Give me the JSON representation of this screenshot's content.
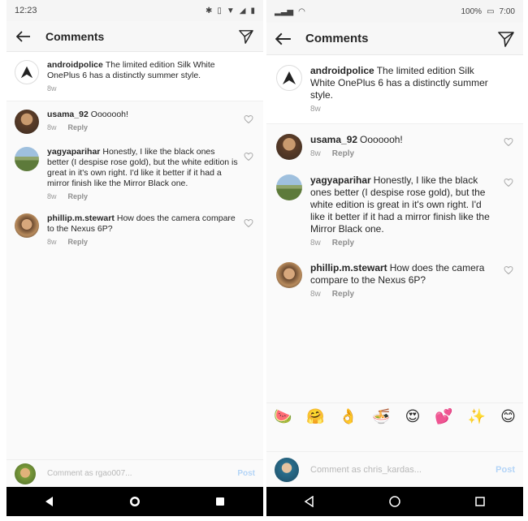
{
  "left": {
    "status": {
      "time": "12:23"
    },
    "appbar": {
      "title": "Comments"
    },
    "caption": {
      "user": "androidpolice",
      "text": "The limited edition Silk White OnePlus 6 has a distinctly summer style.",
      "age": "8w"
    },
    "comments": [
      {
        "user": "usama_92",
        "text": "Ooooooh!",
        "age": "8w",
        "reply": "Reply"
      },
      {
        "user": "yagyaparihar",
        "text": "Honestly, I like the black ones better (I despise rose gold), but the white edition is great in it's own right. I'd like it better if it had a mirror finish like the Mirror Black one.",
        "age": "8w",
        "reply": "Reply"
      },
      {
        "user": "phillip.m.stewart",
        "text": "How does the camera compare to the Nexus 6P?",
        "age": "8w",
        "reply": "Reply"
      }
    ],
    "bottom": {
      "placeholder": "Comment as rgao007...",
      "post": "Post"
    }
  },
  "right": {
    "status": {
      "battery": "100%",
      "time": "7:00"
    },
    "appbar": {
      "title": "Comments"
    },
    "caption": {
      "user": "androidpolice",
      "text": "The limited edition Silk White OnePlus 6 has a distinctly summer style.",
      "age": "8w"
    },
    "comments": [
      {
        "user": "usama_92",
        "text": "Ooooooh!",
        "age": "8w",
        "reply": "Reply"
      },
      {
        "user": "yagyaparihar",
        "text": "Honestly, I like the black ones better (I despise rose gold), but the white edition is great in it's own right. I'd like it better if it had a mirror finish like the Mirror Black one.",
        "age": "8w",
        "reply": "Reply"
      },
      {
        "user": "phillip.m.stewart",
        "text": "How does the camera compare to the Nexus 6P?",
        "age": "8w",
        "reply": "Reply"
      }
    ],
    "emojis": [
      "🍉",
      "🤗",
      "👌",
      "🍜",
      "😍",
      "💕",
      "✨",
      "😊"
    ],
    "bottom": {
      "placeholder": "Comment as chris_kardas...",
      "post": "Post"
    }
  }
}
